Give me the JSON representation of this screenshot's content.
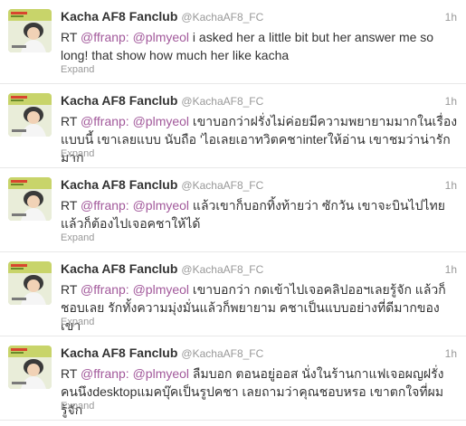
{
  "tweets": [
    {
      "name": "Kacha AF8 Fanclub",
      "handle": "@KachaAF8_FC",
      "time": "1h",
      "rt": "RT",
      "mention1": "@ffranp:",
      "mention2": "@plmyeol",
      "text": " i asked her a little bit but her answer me so long! that show how much her like kacha",
      "expand": "Expand"
    },
    {
      "name": "Kacha AF8 Fanclub",
      "handle": "@KachaAF8_FC",
      "time": "1h",
      "rt": "RT",
      "mention1": "@ffranp:",
      "mention2": "@plmyeol",
      "text": " เขาบอกว่าฝรั่งไม่ค่อยมีความพยายามมากในเรื่องแบบนี้ เขาเลยแบบ นับถือ 'ไอเลยเอาทวิตคชาinterให้อ่าน เขาชมว่าน่ารักมาก",
      "expand": "Expand"
    },
    {
      "name": "Kacha AF8 Fanclub",
      "handle": "@KachaAF8_FC",
      "time": "1h",
      "rt": "RT",
      "mention1": "@ffranp:",
      "mention2": "@plmyeol",
      "text": " แล้วเขาก็บอกทิ้งท้ายว่า ซักวัน เขาจะบินไปไทย แล้วก็ต้องไปเจอคชาให้ได้",
      "expand": "Expand"
    },
    {
      "name": "Kacha AF8 Fanclub",
      "handle": "@KachaAF8_FC",
      "time": "1h",
      "rt": "RT",
      "mention1": "@ffranp:",
      "mention2": "@plmyeol",
      "text": " เขาบอกว่า กดเข้าไปเจอคลิปออฯเลยรู้จัก แล้วก็ชอบเลย รักทั้งความมุ่งมั่นแล้วก็พยายาม คชาเป็นแบบอย่างที่ดีมากของเขา",
      "expand": "Expand"
    },
    {
      "name": "Kacha AF8 Fanclub",
      "handle": "@KachaAF8_FC",
      "time": "1h",
      "rt": "RT",
      "mention1": "@ffranp:",
      "mention2": "@plmyeol",
      "text": " ลืมบอก ตอนอยู่ออส นั่งในร้านกาแฟเจอผญฝรั่งคนนึงdesktopแมคบุ๊คเป็นรูปคชา เลยถามว่าคุณชอบหรอ เขาตกใจที่ผมรู้จัก",
      "expand": "Expand"
    }
  ]
}
